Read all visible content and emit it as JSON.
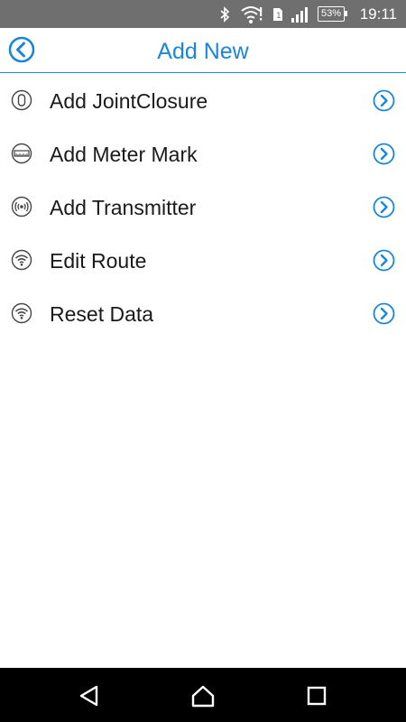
{
  "status_bar": {
    "time": "19:11",
    "battery_percent": "53%",
    "icons": [
      "bluetooth-icon",
      "wifi-alert-icon",
      "sim-icon",
      "signal-icon",
      "battery-icon"
    ]
  },
  "header": {
    "title": "Add New",
    "back_icon": "back-circle-icon"
  },
  "menu": {
    "items": [
      {
        "label": "Add JointClosure",
        "icon": "joint-closure-icon"
      },
      {
        "label": "Add Meter Mark",
        "icon": "meter-mark-icon"
      },
      {
        "label": "Add Transmitter",
        "icon": "transmitter-icon"
      },
      {
        "label": "Edit Route",
        "icon": "wifi-icon"
      },
      {
        "label": "Reset Data",
        "icon": "wifi-icon"
      }
    ]
  },
  "nav_bar": {
    "buttons": [
      "back-triangle-icon",
      "home-icon",
      "recents-icon"
    ]
  },
  "colors": {
    "accent": "#1a86d9",
    "status_bar_bg": "#6f6f6f",
    "nav_bar_bg": "#000000"
  }
}
